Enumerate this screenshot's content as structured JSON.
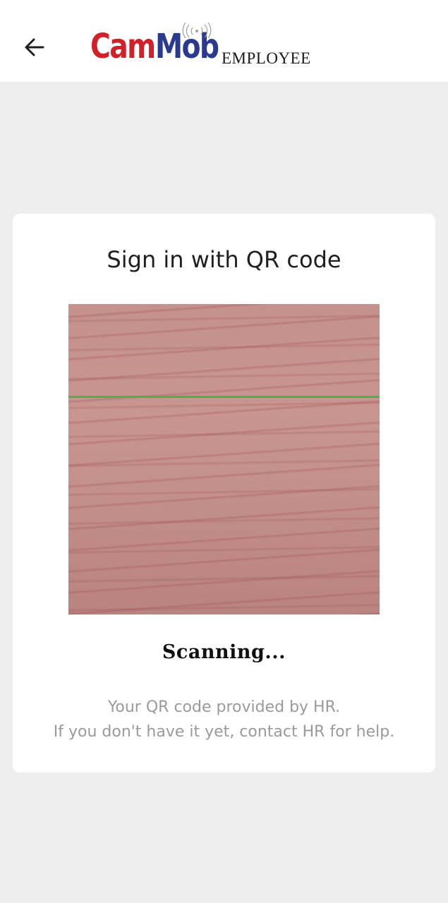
{
  "header": {
    "back_icon": "arrow-left-icon",
    "logo": {
      "part1": "Cam",
      "part2": "Mob",
      "suffix": "EMPLOYEE",
      "colors": {
        "cam": "#d0202a",
        "mob": "#2a3b8f"
      }
    }
  },
  "card": {
    "title": "Sign in with QR code",
    "scanner": {
      "scan_line_color": "#4caf50"
    },
    "status": "Scanning...",
    "help_line1": "Your QR code provided by HR.",
    "help_line2": "If you don't have it yet, contact HR for help."
  }
}
